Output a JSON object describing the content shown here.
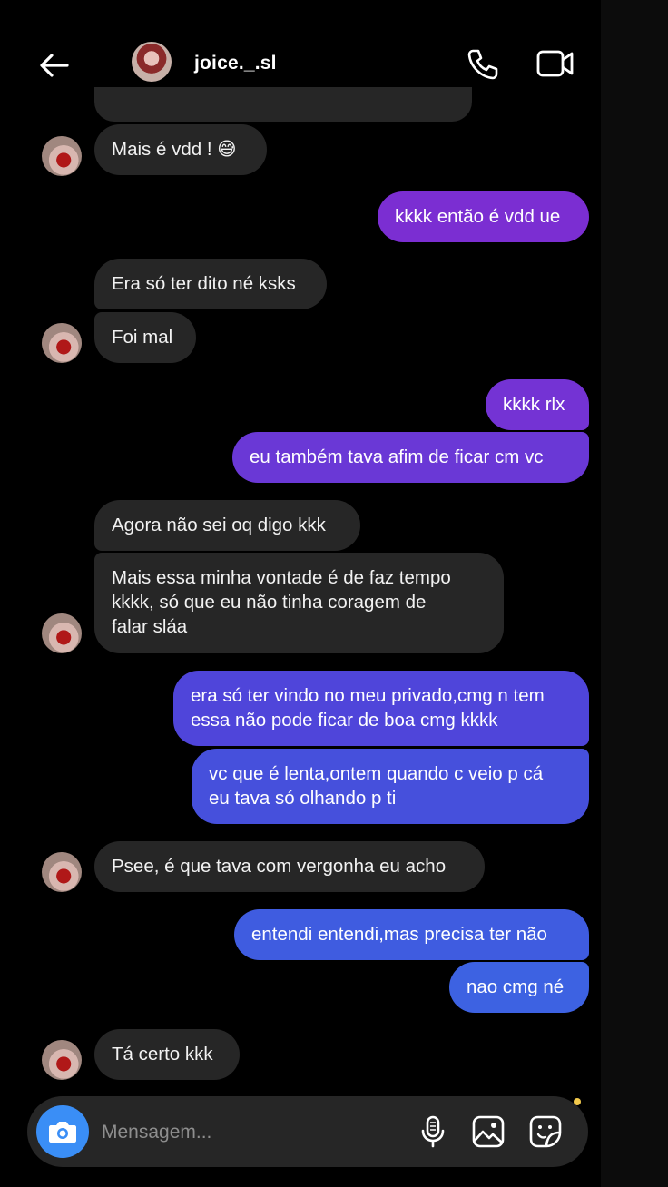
{
  "header": {
    "username": "joice._.sl"
  },
  "messages": [
    {
      "side": "in",
      "text": "Mais é vdd ! 😅"
    },
    {
      "side": "out",
      "text": "kkkk então é vdd ue"
    },
    {
      "side": "in",
      "text": "Era só ter dito né ksks"
    },
    {
      "side": "in",
      "text": "Foi mal"
    },
    {
      "side": "out",
      "text": "kkkk rlx"
    },
    {
      "side": "out",
      "text": "eu também tava afim de ficar cm vc"
    },
    {
      "side": "in",
      "text": "Agora não sei oq digo kkk"
    },
    {
      "side": "in",
      "text": "Mais essa minha vontade é de faz tempo\nkkkk, só que eu não tinha coragem de\nfalar sláa"
    },
    {
      "side": "out",
      "text": "era só ter vindo no meu privado,cmg n tem\nessa não pode ficar de boa cmg kkkk"
    },
    {
      "side": "out",
      "text": "vc que é lenta,ontem quando c veio p cá\neu tava só olhando p ti"
    },
    {
      "side": "in",
      "text": "Psee, é que tava com vergonha eu acho"
    },
    {
      "side": "out",
      "text": "entendi entendi,mas precisa ter não"
    },
    {
      "side": "out",
      "text": "nao cmg né"
    },
    {
      "side": "in",
      "text": "Tá certo kkk"
    }
  ],
  "composer": {
    "placeholder": "Mensagem..."
  },
  "icons": {
    "back": "back-arrow-icon",
    "call": "phone-icon",
    "video": "video-camera-icon",
    "camera": "camera-icon",
    "mic": "microphone-icon",
    "gallery": "image-icon",
    "sticker": "sticker-icon"
  },
  "colors": {
    "incoming_bubble": "#262626",
    "outgoing_top": "#7a2fd0",
    "outgoing_bottom": "#3f5ce0",
    "camera_button": "#3a8ef6"
  }
}
